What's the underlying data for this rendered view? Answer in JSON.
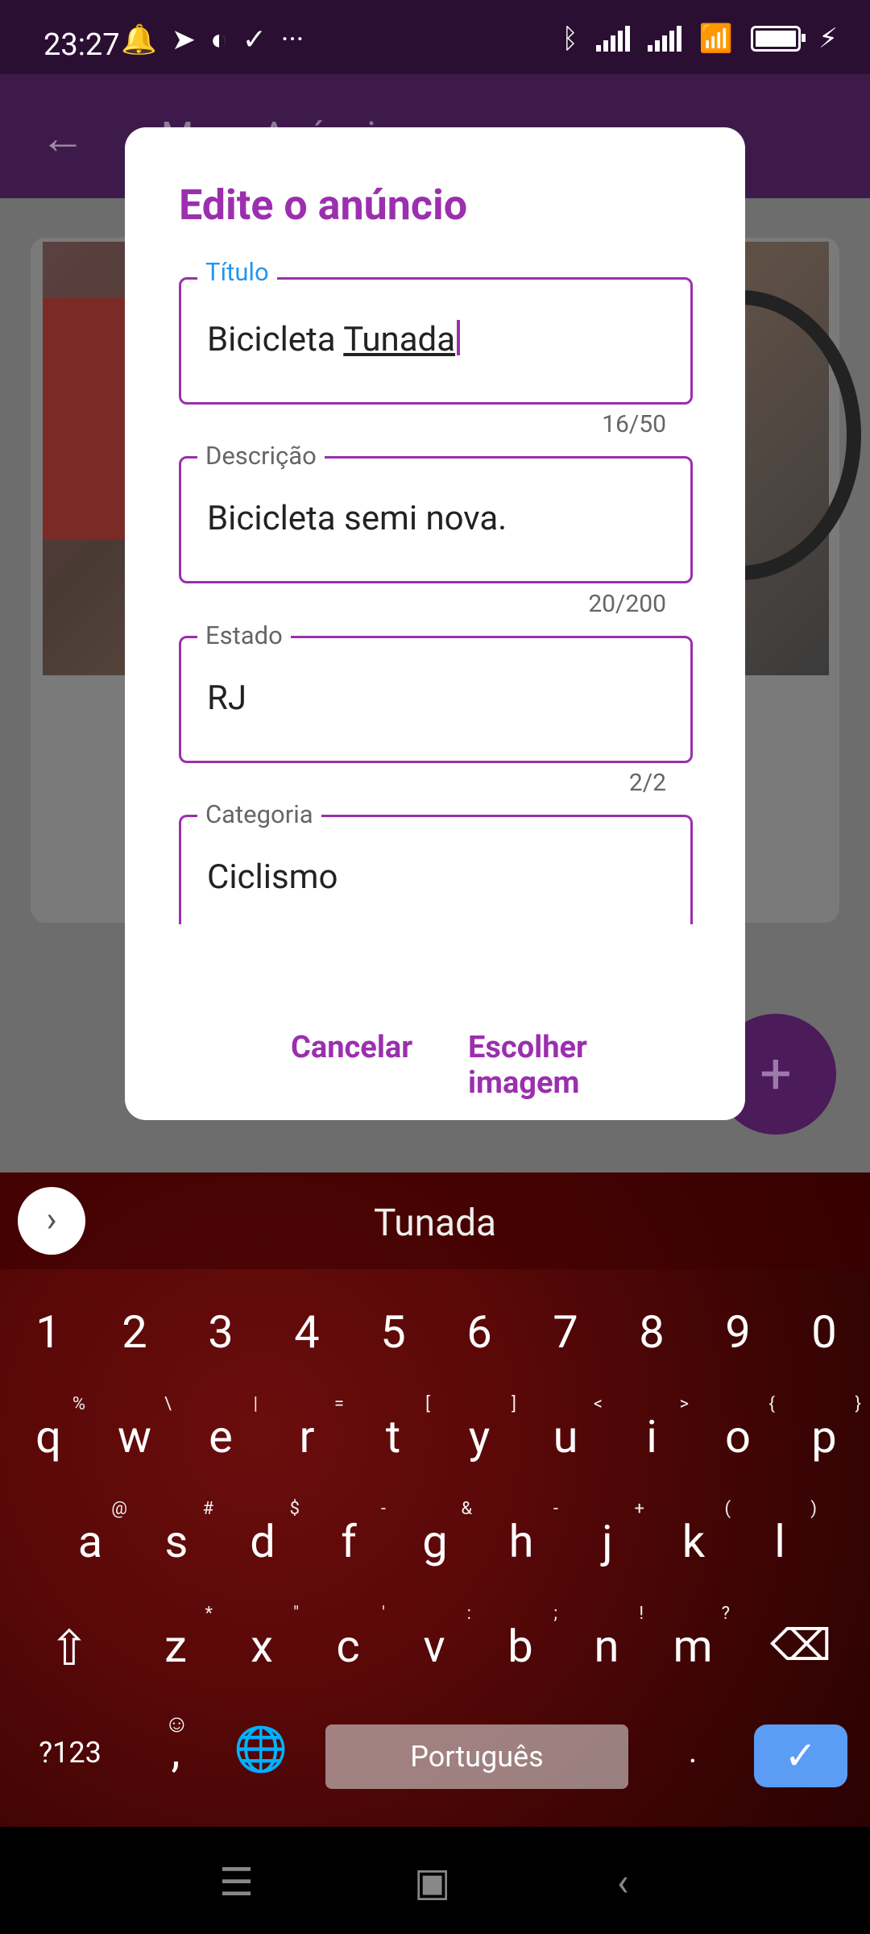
{
  "status_bar": {
    "time": "23:27",
    "left_icons": [
      "alarm-icon",
      "telegram-icon",
      "app-icon",
      "check-icon",
      "more-icon"
    ],
    "right_icons": [
      "bluetooth-icon",
      "signal-icon",
      "signal-icon",
      "wifi-icon",
      "battery-icon",
      "charging-icon"
    ],
    "battery_level": 1.0
  },
  "app_bar": {
    "title": "Meus Anúncios"
  },
  "dialog": {
    "title": "Edite o anúncio",
    "fields": [
      {
        "label": "Título",
        "value_plain": "Bicicleta ",
        "value_underlined": "Tunada",
        "counter": ""
      },
      {
        "label": "Descrição",
        "value": "Bicicleta semi nova.",
        "counter": "16/50"
      },
      {
        "label": "Estado",
        "value": "RJ",
        "counter": "20/200"
      },
      {
        "label": "Categoria",
        "value": "Ciclismo",
        "counter": "2/2"
      }
    ],
    "buttons": {
      "cancel": "Cancelar",
      "choose_image": "Escolher imagem"
    }
  },
  "keyboard": {
    "suggestion": "Tunada",
    "numbers": [
      "1",
      "2",
      "3",
      "4",
      "5",
      "6",
      "7",
      "8",
      "9",
      "0"
    ],
    "row1": [
      {
        "k": "q",
        "s": "%"
      },
      {
        "k": "w",
        "s": "\\"
      },
      {
        "k": "e",
        "s": "|"
      },
      {
        "k": "r",
        "s": "="
      },
      {
        "k": "t",
        "s": "["
      },
      {
        "k": "y",
        "s": "]"
      },
      {
        "k": "u",
        "s": "<"
      },
      {
        "k": "i",
        "s": ">"
      },
      {
        "k": "o",
        "s": "{"
      },
      {
        "k": "p",
        "s": "}"
      }
    ],
    "row2": [
      {
        "k": "a",
        "s": "@"
      },
      {
        "k": "s",
        "s": "#"
      },
      {
        "k": "d",
        "s": "$"
      },
      {
        "k": "f",
        "s": "-"
      },
      {
        "k": "g",
        "s": "&"
      },
      {
        "k": "h",
        "s": "-"
      },
      {
        "k": "j",
        "s": "+"
      },
      {
        "k": "k",
        "s": "("
      },
      {
        "k": "l",
        "s": ")"
      }
    ],
    "row3": [
      {
        "k": "z",
        "s": "*"
      },
      {
        "k": "x",
        "s": "\""
      },
      {
        "k": "c",
        "s": "'"
      },
      {
        "k": "v",
        "s": ":"
      },
      {
        "k": "b",
        "s": ";"
      },
      {
        "k": "n",
        "s": "!"
      },
      {
        "k": "m",
        "s": "?"
      }
    ],
    "symbols_key": "?123",
    "comma_key": ",",
    "space_label": "Português",
    "period_key": "."
  },
  "nav_bar": {
    "icons": [
      "menu-icon",
      "home-icon",
      "back-icon"
    ]
  }
}
